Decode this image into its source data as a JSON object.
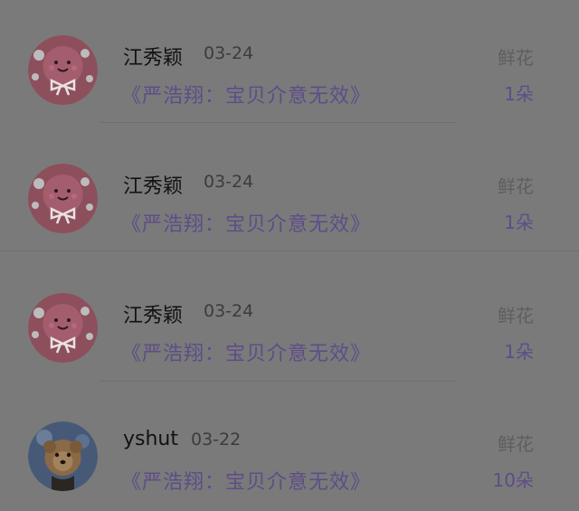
{
  "gift_records": [
    {
      "avatar": "pink-cartoon-avatar",
      "user_name": "江秀颖",
      "date": "03-24",
      "song": "《严浩翔：宝贝介意无效》",
      "gift_type": "鲜花",
      "gift_count": "1朵"
    },
    {
      "avatar": "pink-cartoon-avatar",
      "user_name": "江秀颖",
      "date": "03-24",
      "song": "《严浩翔：宝贝介意无效》",
      "gift_type": "鲜花",
      "gift_count": "1朵"
    },
    {
      "avatar": "pink-cartoon-avatar",
      "user_name": "江秀颖",
      "date": "03-24",
      "song": "《严浩翔：宝贝介意无效》",
      "gift_type": "鲜花",
      "gift_count": "1朵"
    },
    {
      "avatar": "dog-photo-avatar",
      "user_name": "yshut",
      "date": "03-22",
      "song": "《严浩翔：宝贝介意无效》",
      "gift_type": "鲜花",
      "gift_count": "10朵"
    }
  ],
  "colors": {
    "overlay_background": "#7a7a7a",
    "song_title": "#5d4d88",
    "user_name": "#121212"
  }
}
